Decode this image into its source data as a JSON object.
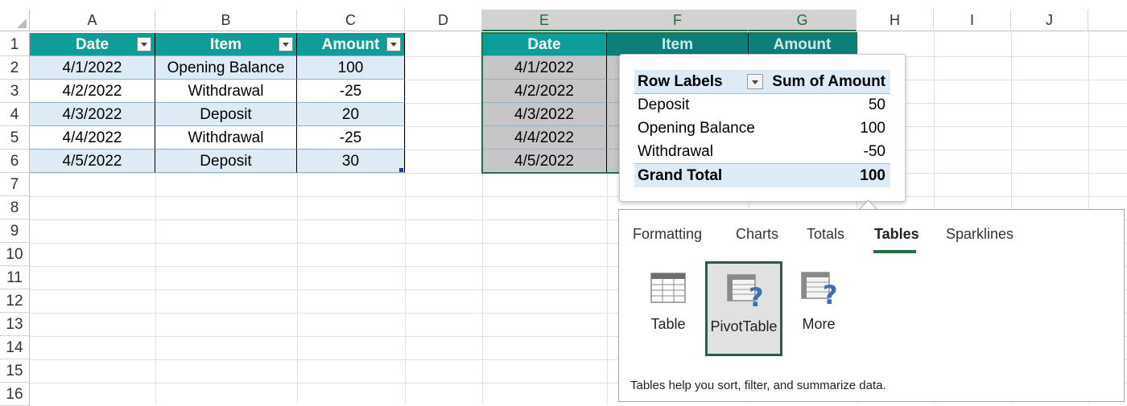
{
  "columns": [
    "A",
    "B",
    "C",
    "D",
    "E",
    "F",
    "G",
    "H",
    "I",
    "J"
  ],
  "rows": [
    "1",
    "2",
    "3",
    "4",
    "5",
    "6",
    "7",
    "8",
    "9",
    "10",
    "11",
    "12",
    "13",
    "14",
    "15",
    "16"
  ],
  "source_table": {
    "headers": [
      "Date",
      "Item",
      "Amount"
    ],
    "rows": [
      [
        "4/1/2022",
        "Opening Balance",
        "100"
      ],
      [
        "4/2/2022",
        "Withdrawal",
        "-25"
      ],
      [
        "4/3/2022",
        "Deposit",
        "20"
      ],
      [
        "4/4/2022",
        "Withdrawal",
        "-25"
      ],
      [
        "4/5/2022",
        "Deposit",
        "30"
      ]
    ]
  },
  "selected_copy": {
    "headers": [
      "Date",
      "Item",
      "Amount"
    ],
    "dates": [
      "4/1/2022",
      "4/2/2022",
      "4/3/2022",
      "4/4/2022",
      "4/5/2022"
    ]
  },
  "pivot_preview": {
    "header_row_labels": "Row Labels",
    "header_sum": "Sum of Amount",
    "rows": [
      {
        "label": "Deposit",
        "value": "50"
      },
      {
        "label": "Opening Balance",
        "value": "100"
      },
      {
        "label": "Withdrawal",
        "value": "-50"
      }
    ],
    "total_label": "Grand Total",
    "total_value": "100"
  },
  "quick_analysis": {
    "tabs": [
      "Formatting",
      "Charts",
      "Totals",
      "Tables",
      "Sparklines"
    ],
    "active_tab": "Tables",
    "tiles": [
      {
        "label": "Table",
        "icon": "table-icon"
      },
      {
        "label": "PivotTable",
        "icon": "pivottable-icon"
      },
      {
        "label": "More",
        "icon": "more-icon"
      }
    ],
    "description": "Tables help you sort, filter, and summarize data."
  },
  "colors": {
    "header_teal": "#0f9d9a",
    "band_blue": "#ddebf7",
    "selection_grey": "#c6c6c6",
    "accent_green": "#217346"
  }
}
